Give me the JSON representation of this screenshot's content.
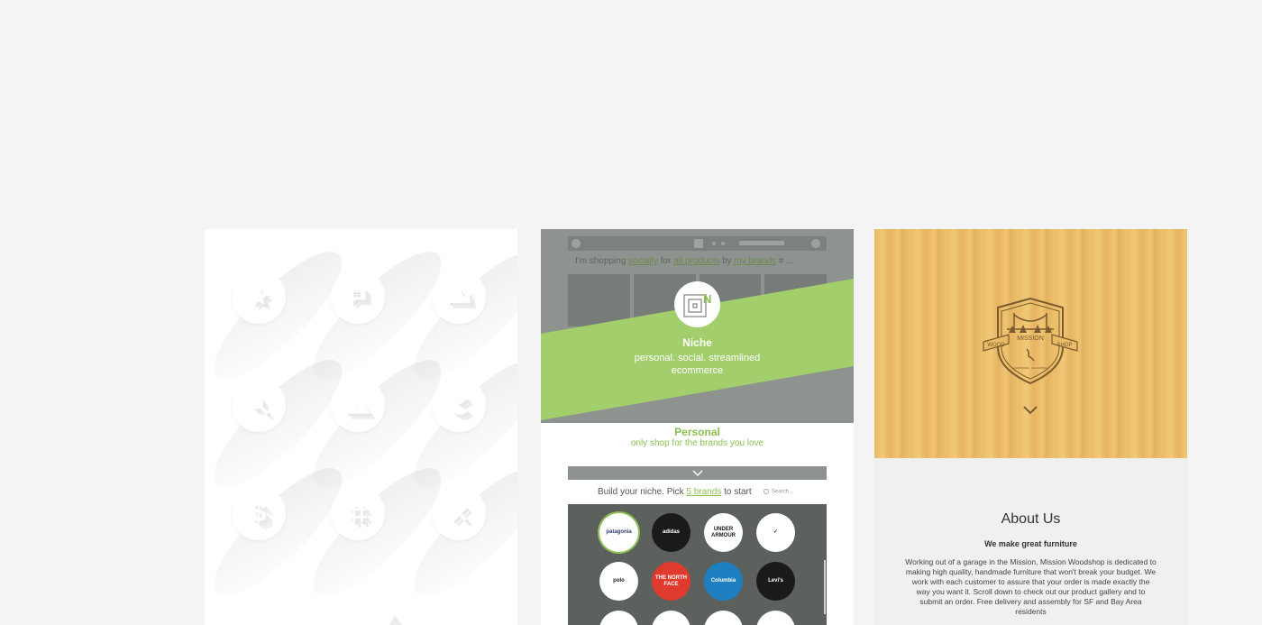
{
  "icons_card": {
    "icons": [
      {
        "name": "star-icon"
      },
      {
        "name": "hashtag-bubble-icon"
      },
      {
        "name": "crown-icon"
      },
      {
        "name": "search-icon"
      },
      {
        "name": "mountain-icon"
      },
      {
        "name": "pacman-icon"
      },
      {
        "name": "dollar-icon"
      },
      {
        "name": "grid-icon"
      },
      {
        "name": "tools-icon"
      }
    ]
  },
  "niche_card": {
    "shopping_prefix": "I'm shopping ",
    "shopping_society": "socially",
    "shopping_for": " for ",
    "shopping_products": "all products",
    "shopping_by": " by ",
    "shopping_brands": "my brands",
    "shopping_suffix": " # ...",
    "logo_letter": "N",
    "title": "Niche",
    "tagline_line1": "personal. social. streamlined",
    "tagline_line2": "ecommerce",
    "personal_title": "Personal",
    "personal_sub": "only shop for the brands you love",
    "build_prefix": "Build your niche. Pick ",
    "build_link": "5 brands",
    "build_suffix": " to start",
    "search_placeholder": "Search...",
    "brands": [
      {
        "label": "patagonia",
        "bg": "#ffffff",
        "fg": "#2a3c6b",
        "selected": true
      },
      {
        "label": "adidas",
        "bg": "#1a1a1a",
        "fg": "#ffffff"
      },
      {
        "label": "UNDER ARMOUR",
        "bg": "#ffffff",
        "fg": "#1a1a1a"
      },
      {
        "label": "✓",
        "bg": "#ffffff",
        "fg": "#1a1a1a"
      },
      {
        "label": "polo",
        "bg": "#ffffff",
        "fg": "#1a1a1a"
      },
      {
        "label": "THE NORTH FACE",
        "bg": "#e03a2f",
        "fg": "#ffffff"
      },
      {
        "label": "Columbia",
        "bg": "#1c7fc0",
        "fg": "#ffffff"
      },
      {
        "label": "Levi's",
        "bg": "#1a1a1a",
        "fg": "#ffffff"
      }
    ]
  },
  "wood_card": {
    "badge_top": "MISSION",
    "badge_left": "WOOD",
    "badge_right": "SHOP",
    "badge_small": "HANDMADE · CALIFORNIA",
    "about_title": "About Us",
    "about_sub": "We make great furniture",
    "about_body": "Working out of a garage in the Mission, Mission Woodshop is dedicated to making high quality, handmade furniture that won't break your budget. We work with each customer to assure that your order is made exactly the way you want it. Scroll down to check out our product gallery and to submit an order. Free delivery and assembly for SF and Bay Area residents"
  }
}
